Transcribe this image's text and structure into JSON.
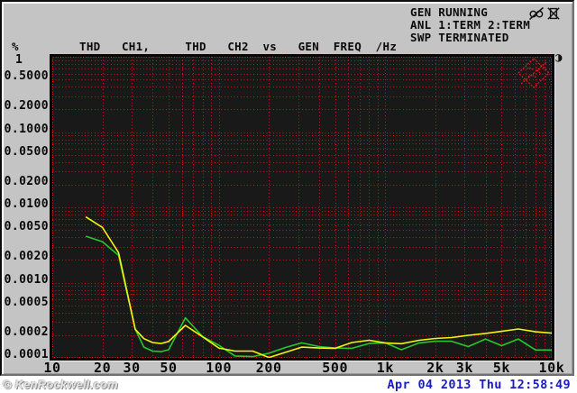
{
  "status_panel": {
    "lines": [
      "GEN RUNNING",
      "ANL 1:TERM 2:TERM",
      "SWP TERMINATED"
    ]
  },
  "icons": {
    "muted_speakers": "speakers-crossed-out",
    "display_off": "display-crossed-out",
    "contrast_glyph": "◑",
    "rs_logo": "rohde-schwarz-diamond-crossed"
  },
  "header": {
    "unit": "%",
    "title_display": "THD   CH1,     THD   CH2  vs   GEN  FREQ  /Hz"
  },
  "chart_data": {
    "type": "line",
    "title": "THD CH1, THD CH2 vs GEN FREQ /Hz",
    "xlabel": "GEN FREQ /Hz",
    "ylabel": "THD %",
    "x_axis": {
      "scale": "log",
      "min": 10,
      "max": 10000,
      "ticks": [
        [
          10,
          "10"
        ],
        [
          20,
          "20"
        ],
        [
          30,
          "30"
        ],
        [
          50,
          "50"
        ],
        [
          100,
          "100"
        ],
        [
          200,
          "200"
        ],
        [
          500,
          "500"
        ],
        [
          1000,
          "1k"
        ],
        [
          2000,
          "2k"
        ],
        [
          3000,
          "3k"
        ],
        [
          5000,
          "5k"
        ],
        [
          10000,
          "10k"
        ]
      ]
    },
    "y_axis": {
      "scale": "log",
      "min": 0.0001,
      "max": 1,
      "ticks": [
        [
          1,
          "1"
        ],
        [
          0.5,
          "0.5000"
        ],
        [
          0.2,
          "0.2000"
        ],
        [
          0.1,
          "0.1000"
        ],
        [
          0.05,
          "0.0500"
        ],
        [
          0.02,
          "0.0200"
        ],
        [
          0.01,
          "0.0100"
        ],
        [
          0.005,
          "0.0050"
        ],
        [
          0.002,
          "0.0020"
        ],
        [
          0.001,
          "0.0010"
        ],
        [
          0.0005,
          "0.0005"
        ],
        [
          0.0002,
          "0.0002"
        ],
        [
          0.0001,
          "0.0001"
        ]
      ]
    },
    "grid": {
      "style": "dotted",
      "color": "#c81616",
      "frame_color": "#e82020",
      "background": "#191919"
    },
    "legend_position": "none",
    "series": [
      {
        "name": "THD CH1",
        "color": "#f4f410",
        "points": [
          [
            16,
            0.0074
          ],
          [
            20,
            0.0054
          ],
          [
            25,
            0.0025
          ],
          [
            31.5,
            0.00024
          ],
          [
            35.5,
            0.00018
          ],
          [
            40,
            0.00016
          ],
          [
            45,
            0.000155
          ],
          [
            50,
            0.000165
          ],
          [
            63,
            0.00027
          ],
          [
            80,
            0.00019
          ],
          [
            100,
            0.000135
          ],
          [
            125,
            0.000123
          ],
          [
            160,
            0.000123
          ],
          [
            200,
            0.000101
          ],
          [
            250,
            0.000118
          ],
          [
            315,
            0.000139
          ],
          [
            400,
            0.000135
          ],
          [
            500,
            0.000134
          ],
          [
            630,
            0.00016
          ],
          [
            800,
            0.000171
          ],
          [
            1000,
            0.000158
          ],
          [
            1250,
            0.000154
          ],
          [
            1600,
            0.000171
          ],
          [
            2000,
            0.000181
          ],
          [
            2500,
            0.000186
          ],
          [
            3150,
            0.000199
          ],
          [
            4000,
            0.000211
          ],
          [
            5000,
            0.000225
          ],
          [
            6300,
            0.000242
          ],
          [
            8000,
            0.000222
          ],
          [
            10000,
            0.000213
          ]
        ]
      },
      {
        "name": "THD CH2",
        "color": "#28c828",
        "points": [
          [
            16,
            0.0041
          ],
          [
            20,
            0.0035
          ],
          [
            25,
            0.0023
          ],
          [
            31.5,
            0.00024
          ],
          [
            35.5,
            0.000139
          ],
          [
            40,
            0.000123
          ],
          [
            45,
            0.000121
          ],
          [
            50,
            0.000128
          ],
          [
            63,
            0.00034
          ],
          [
            80,
            0.000191
          ],
          [
            100,
            0.000147
          ],
          [
            125,
            0.000106
          ],
          [
            160,
            0.000104
          ],
          [
            200,
            0.000115
          ],
          [
            250,
            0.000137
          ],
          [
            315,
            0.000158
          ],
          [
            400,
            0.000141
          ],
          [
            500,
            0.000135
          ],
          [
            630,
            0.000134
          ],
          [
            800,
            0.000155
          ],
          [
            1000,
            0.000158
          ],
          [
            1250,
            0.000128
          ],
          [
            1600,
            0.000158
          ],
          [
            2000,
            0.000166
          ],
          [
            2500,
            0.000166
          ],
          [
            3150,
            0.000141
          ],
          [
            4000,
            0.000178
          ],
          [
            5000,
            0.000145
          ],
          [
            6300,
            0.000178
          ],
          [
            8000,
            0.000127
          ],
          [
            10000,
            0.000127
          ]
        ]
      }
    ]
  },
  "footer": {
    "watermark": "© KenRockwell.com",
    "datetime": "Apr 04 2013 Thu 12:58:49"
  }
}
